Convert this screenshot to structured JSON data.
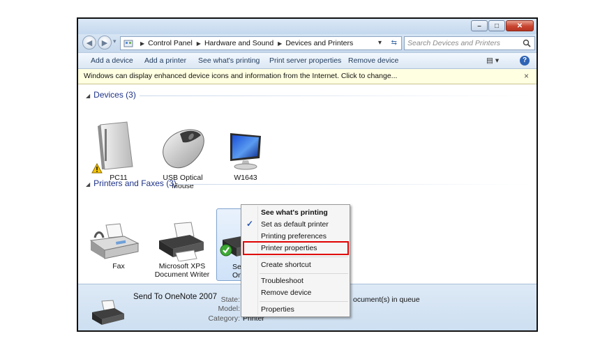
{
  "window": {
    "buttons": {
      "minimize_glyph": "–",
      "maximize_glyph": "□",
      "close_glyph": "✕"
    }
  },
  "nav": {
    "back_glyph": "◀",
    "forward_glyph": "▶",
    "history_glyph": "▾"
  },
  "address": {
    "icon": "control-panel-icon",
    "breadcrumbs": [
      "Control Panel",
      "Hardware and Sound",
      "Devices and Printers"
    ],
    "separator": "▶",
    "dropdown_glyph": "▾",
    "refresh_glyph": "⇆"
  },
  "search": {
    "placeholder": "Search Devices and Printers",
    "icon": "search-icon"
  },
  "toolbar": {
    "items": [
      "Add a device",
      "Add a printer",
      "See what's printing",
      "Print server properties",
      "Remove device"
    ],
    "view_glyph": "▤ ▾",
    "help_glyph": "?"
  },
  "infobar": {
    "message": "Windows can display enhanced device icons and information from the Internet. Click to change...",
    "close_glyph": "×"
  },
  "groups": {
    "devices": {
      "title": "Devices (3)",
      "items": [
        {
          "label": "PC11",
          "icon": "computer-tower-icon",
          "warning": true
        },
        {
          "label": "USB Optical Mouse",
          "icon": "mouse-icon"
        },
        {
          "label": "W1643",
          "icon": "monitor-icon"
        }
      ]
    },
    "printers": {
      "title": "Printers and Faxes (3)",
      "items": [
        {
          "label": "Fax",
          "icon": "fax-icon"
        },
        {
          "label": "Microsoft XPS Document Writer",
          "icon": "printer-icon"
        },
        {
          "label_line1": "Sen",
          "label_line2": "OneN",
          "icon": "printer-icon",
          "default": true,
          "selected": true
        }
      ]
    }
  },
  "details": {
    "name": "Send To OneNote 2007",
    "state_label": "State:",
    "model_label": "Model:",
    "category_label": "Category:",
    "category_value": "Printer",
    "queue_text": "ocument(s) in queue"
  },
  "context_menu": {
    "items": [
      {
        "label": "See what's printing",
        "bold": true
      },
      {
        "label": "Set as default printer",
        "checked": true
      },
      {
        "label": "Printing preferences"
      },
      {
        "label": "Printer properties",
        "highlighted": true
      },
      {
        "label": "Create shortcut"
      },
      {
        "label": "Troubleshoot"
      },
      {
        "label": "Remove device"
      },
      {
        "label": "Properties"
      }
    ],
    "check_glyph": "✓"
  },
  "colors": {
    "accent": "#1e3287",
    "highlight_box": "#e00000",
    "selection": "#cfe2f8",
    "infobar": "#ffffe1"
  }
}
